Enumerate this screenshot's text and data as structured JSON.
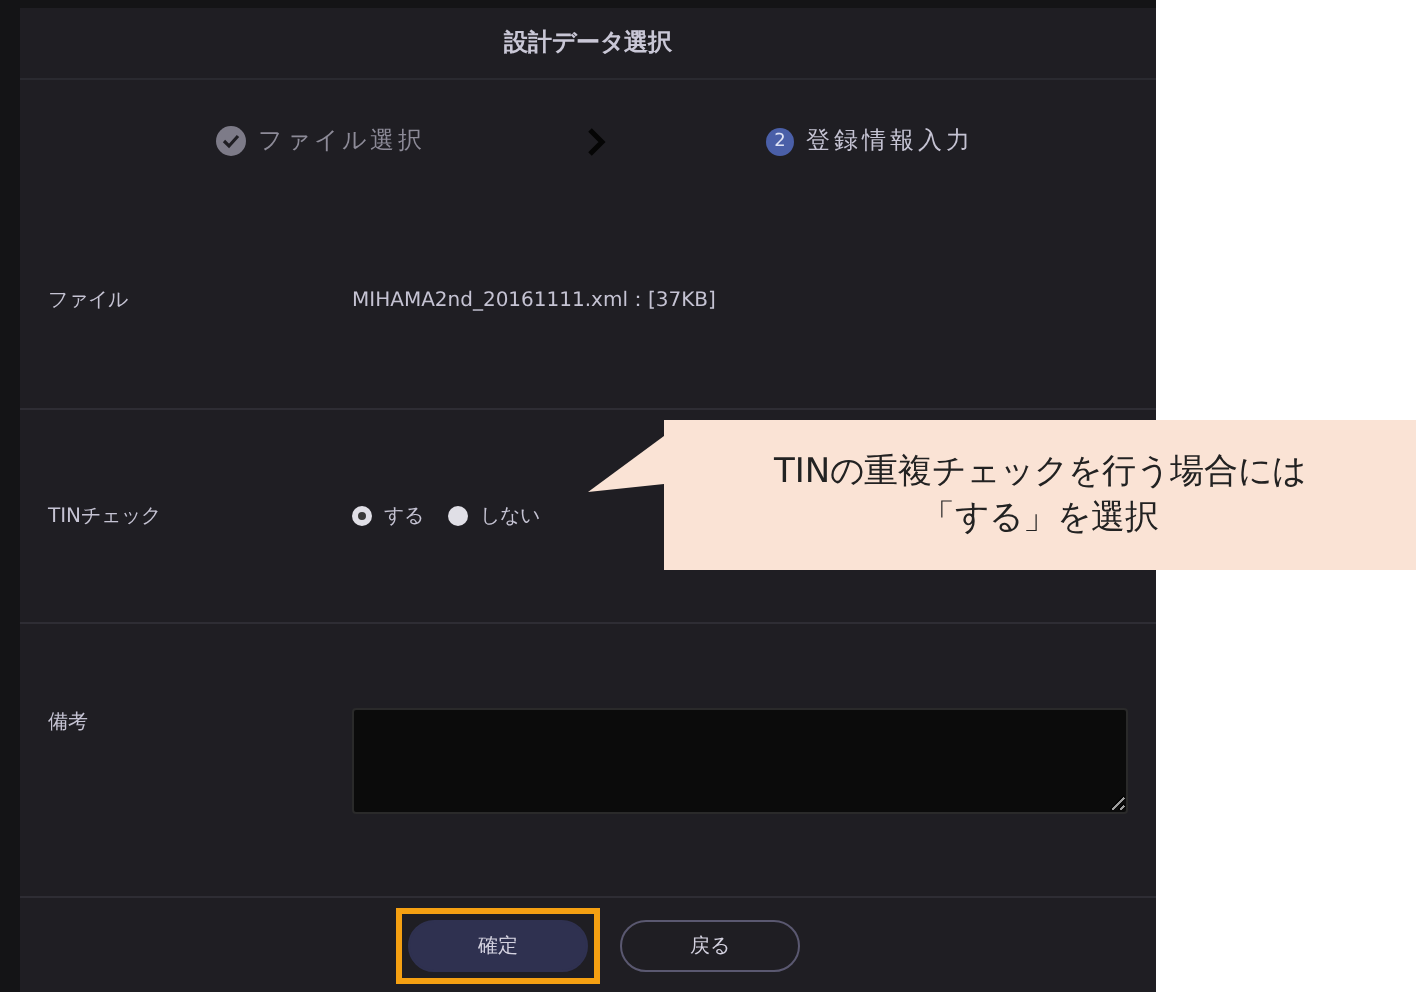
{
  "dialog": {
    "title": "設計データ選択"
  },
  "steps": [
    {
      "kind": "done",
      "label": "ファイル選択"
    },
    {
      "kind": "current",
      "number": "2",
      "label": "登録情報入力"
    }
  ],
  "file_row": {
    "label": "ファイル",
    "value": "MIHAMA2nd_20161111.xml：[37KB]"
  },
  "tin_row": {
    "label": "TINチェック",
    "options": [
      {
        "label": "する",
        "selected": true
      },
      {
        "label": "しない",
        "selected": false
      }
    ]
  },
  "remarks_row": {
    "label": "備考"
  },
  "buttons": [
    {
      "kind": "primary",
      "label": "確定",
      "highlighted": true
    },
    {
      "kind": "secondary",
      "label": "戻る",
      "highlighted": false
    }
  ],
  "callout": {
    "lines": [
      "TINの重複チェックを行う場合には",
      "「する」を選択"
    ]
  }
}
